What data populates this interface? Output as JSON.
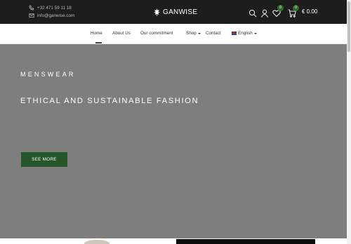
{
  "topbar": {
    "phone": "+32 471 59 11 18",
    "email": "info@ganwise.com",
    "phone_icon": "phone-icon",
    "email_icon": "mail-icon"
  },
  "brand": {
    "name": "GANWISE",
    "icon": "leaf-logo-icon"
  },
  "actions": {
    "search_icon": "search-icon",
    "account_icon": "user-icon",
    "wishlist_icon": "heart-icon",
    "wishlist_count": "0",
    "cart_icon": "cart-icon",
    "cart_count": "0",
    "cart_total": "€ 0.00"
  },
  "nav": {
    "items": [
      {
        "label": "Home",
        "active": true
      },
      {
        "label": "About Us"
      },
      {
        "label": "Our commitment"
      },
      {
        "label": "Shop",
        "dropdown": true
      },
      {
        "label": "Contact"
      },
      {
        "label": "English",
        "dropdown": true,
        "flag": "uk-flag-icon"
      }
    ]
  },
  "hero": {
    "eyebrow": "MENSWEAR",
    "title": "ETHICAL AND SUSTAINABLE FASHION",
    "cta_label": "SEE MORE"
  },
  "colors": {
    "topbar_bg": "#1d1d1d",
    "hero_bg": "#7e7e7e",
    "accent_green": "#25562a",
    "badge_green": "#2f6b2a"
  }
}
